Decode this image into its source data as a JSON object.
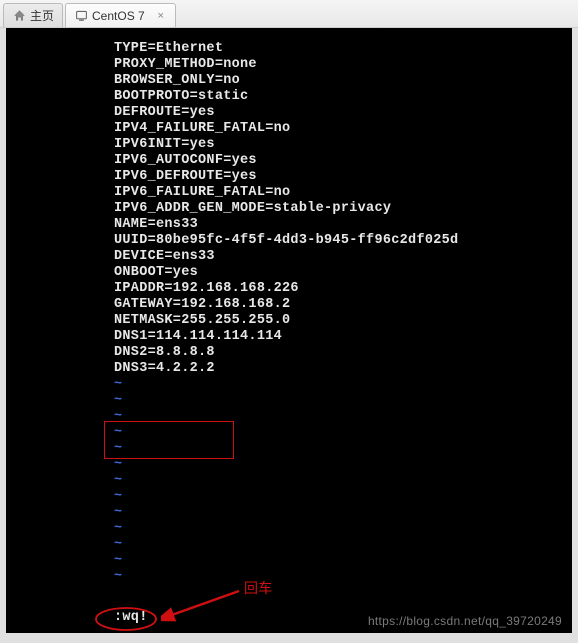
{
  "tabs": {
    "home": {
      "label": "主页"
    },
    "centos": {
      "label": "CentOS 7",
      "close": "×"
    }
  },
  "config_lines": [
    "TYPE=Ethernet",
    "PROXY_METHOD=none",
    "BROWSER_ONLY=no",
    "BOOTPROTO=static",
    "DEFROUTE=yes",
    "IPV4_FAILURE_FATAL=no",
    "IPV6INIT=yes",
    "IPV6_AUTOCONF=yes",
    "IPV6_DEFROUTE=yes",
    "IPV6_FAILURE_FATAL=no",
    "IPV6_ADDR_GEN_MODE=stable-privacy",
    "NAME=ens33",
    "UUID=80be95fc-4f5f-4dd3-b945-ff96c2df025d",
    "DEVICE=ens33",
    "ONBOOT=yes",
    "IPADDR=192.168.168.226",
    "GATEWAY=192.168.168.2",
    "NETMASK=255.255.255.0",
    "DNS1=114.114.114.114",
    "DNS2=8.8.8.8",
    "DNS3=4.2.2.2"
  ],
  "tilde": "~",
  "tilde_count": 13,
  "cmd": ":wq!",
  "annotation": "回车",
  "watermark": "https://blog.csdn.net/qq_39720249"
}
